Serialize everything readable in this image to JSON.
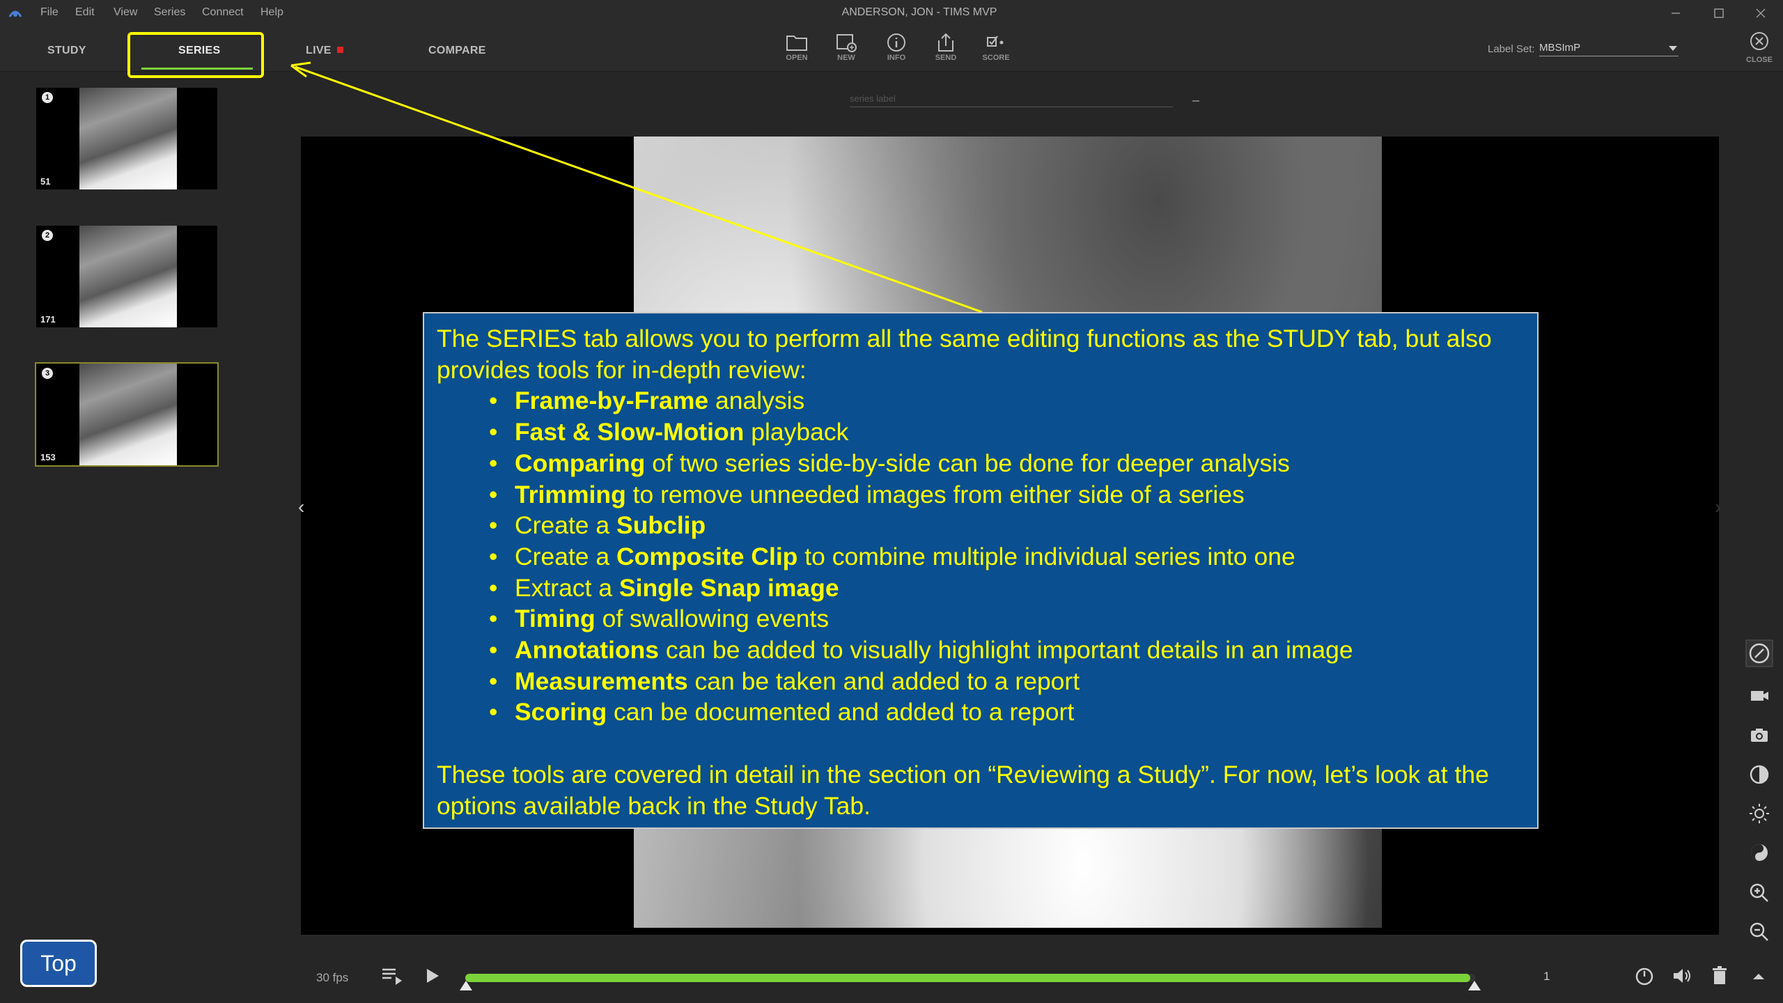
{
  "window": {
    "title": "ANDERSON, JON - TIMS MVP",
    "menu": [
      "File",
      "Edit",
      "View",
      "Series",
      "Connect",
      "Help"
    ]
  },
  "tabs": {
    "study": "STUDY",
    "series": "SERIES",
    "live": "LIVE",
    "compare": "COMPARE"
  },
  "toolbar": {
    "tools": [
      {
        "label": "OPEN",
        "icon": "folder-icon"
      },
      {
        "label": "NEW",
        "icon": "new-series-icon"
      },
      {
        "label": "INFO",
        "icon": "info-icon"
      },
      {
        "label": "SEND",
        "icon": "share-icon"
      },
      {
        "label": "SCORE",
        "icon": "score-icon"
      }
    ],
    "label_set_caption": "Label Set:",
    "label_set_value": "MBSImP",
    "close_label": "CLOSE"
  },
  "thumbnails": [
    {
      "number": "1",
      "count": "51",
      "selected": false
    },
    {
      "number": "2",
      "count": "171",
      "selected": false
    },
    {
      "number": "3",
      "count": "153",
      "selected": true
    }
  ],
  "viewer": {
    "series_label_placeholder": "series label"
  },
  "playback": {
    "fps": "30 fps",
    "frame": "1",
    "progress": 0.995
  },
  "callout": {
    "intro": "The SERIES tab allows you to perform all the same editing functions as the STUDY tab, but also provides tools for in-depth review:",
    "bullets": [
      {
        "pre": "",
        "bold": "Frame-by-Frame",
        "post": " analysis"
      },
      {
        "pre": "",
        "bold": "Fast & Slow-Motion",
        "post": " playback"
      },
      {
        "pre": "",
        "bold": "Comparing",
        "post": " of two series side-by-side can be done for deeper analysis"
      },
      {
        "pre": "",
        "bold": "Trimming",
        "post": " to remove unneeded images from either side of a series"
      },
      {
        "pre": "Create a ",
        "bold": "Subclip",
        "post": ""
      },
      {
        "pre": "Create a ",
        "bold": "Composite Clip",
        "post": " to combine multiple individual series into one"
      },
      {
        "pre": "Extract a ",
        "bold": "Single Snap image",
        "post": ""
      },
      {
        "pre": "",
        "bold": "Timing",
        "post": " of swallowing events"
      },
      {
        "pre": "",
        "bold": "Annotations",
        "post": " can be added to visually highlight important details in an image"
      },
      {
        "pre": "",
        "bold": "Measurements",
        "post": " can be taken and added to a report"
      },
      {
        "pre": "",
        "bold": "Scoring",
        "post": " can be documented and added to a report"
      }
    ],
    "outro": "These tools are covered in detail in the section on “Reviewing a Study”. For now, let’s look at the options available back in the Study Tab."
  },
  "top_button": "Top",
  "colors": {
    "highlight": "#ffff00",
    "callout_bg": "#0a4f8f",
    "progress": "#7bd33a",
    "live": "#e02424"
  }
}
